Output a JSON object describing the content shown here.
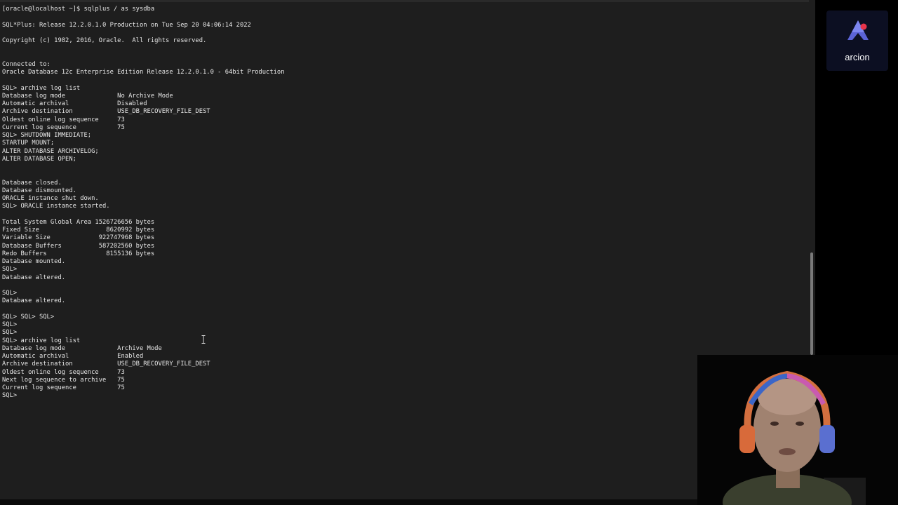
{
  "terminal": {
    "lines": [
      "[oracle@localhost ~]$ sqlplus / as sysdba",
      "",
      "SQL*Plus: Release 12.2.0.1.0 Production on Tue Sep 20 04:06:14 2022",
      "",
      "Copyright (c) 1982, 2016, Oracle.  All rights reserved.",
      "",
      "",
      "Connected to:",
      "Oracle Database 12c Enterprise Edition Release 12.2.0.1.0 - 64bit Production",
      "",
      "SQL> archive log list",
      "Database log mode              No Archive Mode",
      "Automatic archival             Disabled",
      "Archive destination            USE_DB_RECOVERY_FILE_DEST",
      "Oldest online log sequence     73",
      "Current log sequence           75",
      "SQL> SHUTDOWN IMMEDIATE;",
      "STARTUP MOUNT;",
      "ALTER DATABASE ARCHIVELOG;",
      "ALTER DATABASE OPEN;",
      "",
      "",
      "Database closed.",
      "Database dismounted.",
      "ORACLE instance shut down.",
      "SQL> ORACLE instance started.",
      "",
      "Total System Global Area 1526726656 bytes",
      "Fixed Size                  8620992 bytes",
      "Variable Size             922747968 bytes",
      "Database Buffers          587202560 bytes",
      "Redo Buffers                8155136 bytes",
      "Database mounted.",
      "SQL>",
      "Database altered.",
      "",
      "SQL>",
      "Database altered.",
      "",
      "SQL> SQL> SQL>",
      "SQL>",
      "SQL>",
      "SQL> archive log list",
      "Database log mode              Archive Mode",
      "Automatic archival             Enabled",
      "Archive destination            USE_DB_RECOVERY_FILE_DEST",
      "Oldest online log sequence     73",
      "Next log sequence to archive   75",
      "Current log sequence           75",
      "SQL>"
    ]
  },
  "logo": {
    "text": "arcion"
  },
  "icons": {
    "text_cursor": "ibeam-cursor-icon",
    "logo_mark": "arcion-logo-icon"
  },
  "colors": {
    "terminal_bg": "#1e1e1e",
    "terminal_fg": "#e8e8e8",
    "logo_bg": "#0c0f22",
    "logo_accent": "#e8344a"
  }
}
